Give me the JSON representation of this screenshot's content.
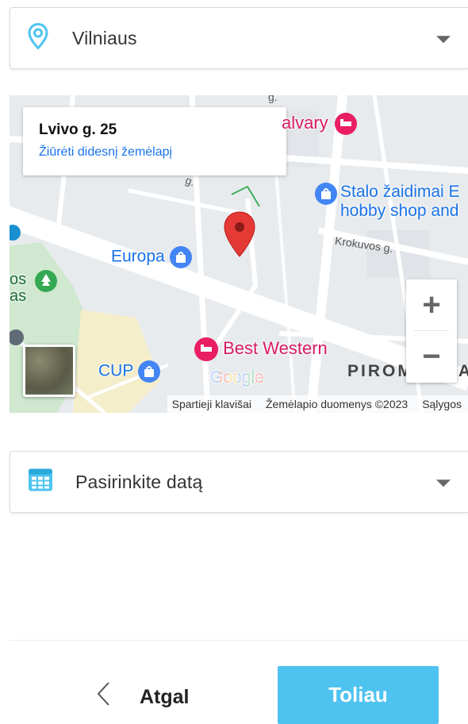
{
  "city_select": {
    "value": "Vilniaus",
    "icon": "location-pin-icon"
  },
  "map": {
    "info_card": {
      "address": "Lvivo g. 25",
      "link": "Žiūrėti didesnį žemėlapį"
    },
    "pois": {
      "calvary": "alvary",
      "stalo_line1": "Stalo žaidimai E",
      "stalo_line2": "hobby shop and",
      "europa": "Europa",
      "best_western": "Best Western",
      "cup": "CUP",
      "park_line1": "os",
      "park_line2": "as"
    },
    "streets": {
      "krokuvos": "Krokuvos g.",
      "g": "g.",
      "street_top": "g."
    },
    "district": "PIROM",
    "district_tail": "A",
    "zoom_in": "+",
    "zoom_out": "−",
    "google": "Google",
    "attribution": {
      "shortcuts": "Spartieji klavišai",
      "data": "Žemėlapio duomenys ©2023",
      "terms": "Sąlygos"
    }
  },
  "date_select": {
    "placeholder": "Pasirinkite datą",
    "icon": "calendar-icon"
  },
  "footer": {
    "back_label": "Atgal",
    "next_label": "Toliau"
  },
  "colors": {
    "accent": "#4fc3f0",
    "pin": "#e53935",
    "poi_blue": "#1a73e8",
    "poi_pink": "#d81b60"
  }
}
